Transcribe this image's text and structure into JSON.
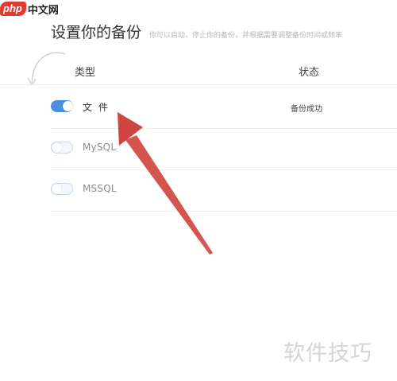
{
  "site_logo": {
    "php": "php",
    "cn": "中文网"
  },
  "header": {
    "title": "设置你的备份",
    "subtitle": "你可以启动，停止你的备份，并根据需要调整备份时间或频率"
  },
  "table": {
    "columns": [
      "类型",
      "状态"
    ],
    "rows": [
      {
        "name": "文件",
        "enabled": true,
        "status": "备份成功"
      },
      {
        "name": "MySQL",
        "enabled": false,
        "status": ""
      },
      {
        "name": "MSSQL",
        "enabled": false,
        "status": ""
      }
    ]
  },
  "watermark": "软件技巧",
  "colors": {
    "accent": "#4a8fe0",
    "annotation_arrow": "#d0453f",
    "logo": "#e3392f"
  },
  "icons": [
    "toggle-switch-icon",
    "annotation-arrow-icon",
    "curved-arrow-icon"
  ]
}
